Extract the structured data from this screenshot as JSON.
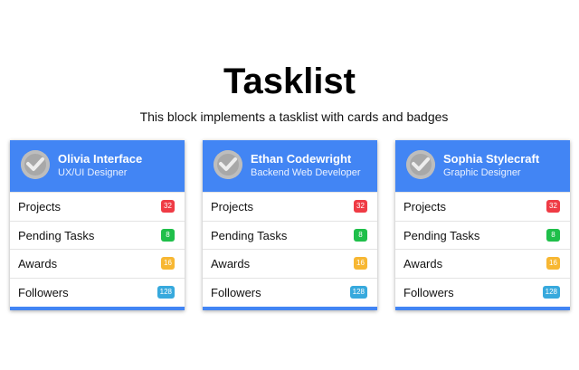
{
  "page": {
    "title": "Tasklist",
    "subtitle": "This block implements a tasklist with cards and badges"
  },
  "colors": {
    "header": "#4285f4",
    "badge_projects": "#ef3b45",
    "badge_pending": "#1fbf4a",
    "badge_awards": "#f7b733",
    "badge_followers": "#37a9dd"
  },
  "cards": [
    {
      "name": "Olivia Interface",
      "role": "UX/UI Designer",
      "avatar_icon": "check-avatar-icon",
      "rows": [
        {
          "label": "Projects",
          "badge": "32"
        },
        {
          "label": "Pending Tasks",
          "badge": "8"
        },
        {
          "label": "Awards",
          "badge": "16"
        },
        {
          "label": "Followers",
          "badge": "128"
        }
      ]
    },
    {
      "name": "Ethan Codewright",
      "role": "Backend Web Developer",
      "avatar_icon": "check-avatar-icon",
      "rows": [
        {
          "label": "Projects",
          "badge": "32"
        },
        {
          "label": "Pending Tasks",
          "badge": "8"
        },
        {
          "label": "Awards",
          "badge": "16"
        },
        {
          "label": "Followers",
          "badge": "128"
        }
      ]
    },
    {
      "name": "Sophia Stylecraft",
      "role": "Graphic Designer",
      "avatar_icon": "check-avatar-icon",
      "rows": [
        {
          "label": "Projects",
          "badge": "32"
        },
        {
          "label": "Pending Tasks",
          "badge": "8"
        },
        {
          "label": "Awards",
          "badge": "16"
        },
        {
          "label": "Followers",
          "badge": "128"
        }
      ]
    }
  ]
}
